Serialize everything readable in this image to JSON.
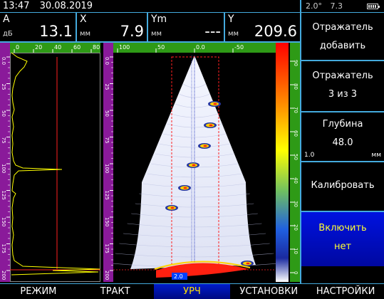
{
  "status": {
    "time": "13:47",
    "date": "30.08.2019"
  },
  "readouts": [
    {
      "label": "A",
      "unit": "дБ",
      "value": "13.1"
    },
    {
      "label": "X",
      "unit": "мм",
      "value": "7.9"
    },
    {
      "label": "Ym",
      "unit": "мм",
      "value": "---"
    },
    {
      "label": "Y",
      "unit": "мм",
      "value": "209.6"
    }
  ],
  "sidebar": {
    "angle": "2.0°",
    "freq": "7.3",
    "battery_icon": "battery-icon",
    "buttons": [
      {
        "line1": "Отражатель",
        "line2": "добавить"
      },
      {
        "line1": "Отражатель",
        "line2": "3 из 3"
      },
      {
        "line1": "Глубина",
        "line2": "48.0",
        "min": "1.0",
        "unit": "мм"
      },
      {
        "line1": "Калибровать",
        "line2": ""
      },
      {
        "line1": "Включить",
        "line2": "нет"
      }
    ]
  },
  "tabs": [
    {
      "label": "РЕЖИМ"
    },
    {
      "label": "ТРАКТ"
    },
    {
      "label": "УРЧ"
    },
    {
      "label": "УСТАНОВКИ"
    },
    {
      "label": "НАСТРОЙКИ"
    }
  ],
  "active_tab": "УРЧ",
  "ascan": {
    "top_ticks": [
      "0",
      "20",
      "40",
      "60",
      "80"
    ],
    "side_ticks": [
      "0.0",
      "25",
      "50",
      "75",
      "100",
      "125",
      "150",
      "175",
      "200"
    ]
  },
  "sector": {
    "top_ticks": [
      "100",
      "50",
      "0.0",
      "-50"
    ],
    "side_ticks": [
      "0.0",
      "25",
      "50",
      "75",
      "100",
      "125",
      "150",
      "175",
      "200"
    ],
    "gate_label": "2.0"
  },
  "colorbar": {
    "ticks": [
      "90",
      "80",
      "70",
      "60",
      "50",
      "40",
      "30",
      "20",
      "10",
      "0"
    ]
  },
  "colors": {
    "accent": "#44aadd",
    "ruler": "#8a1a9a",
    "ruler_green": "#2e9a16",
    "signal": "#ffff00",
    "gate": "#ff2020"
  }
}
